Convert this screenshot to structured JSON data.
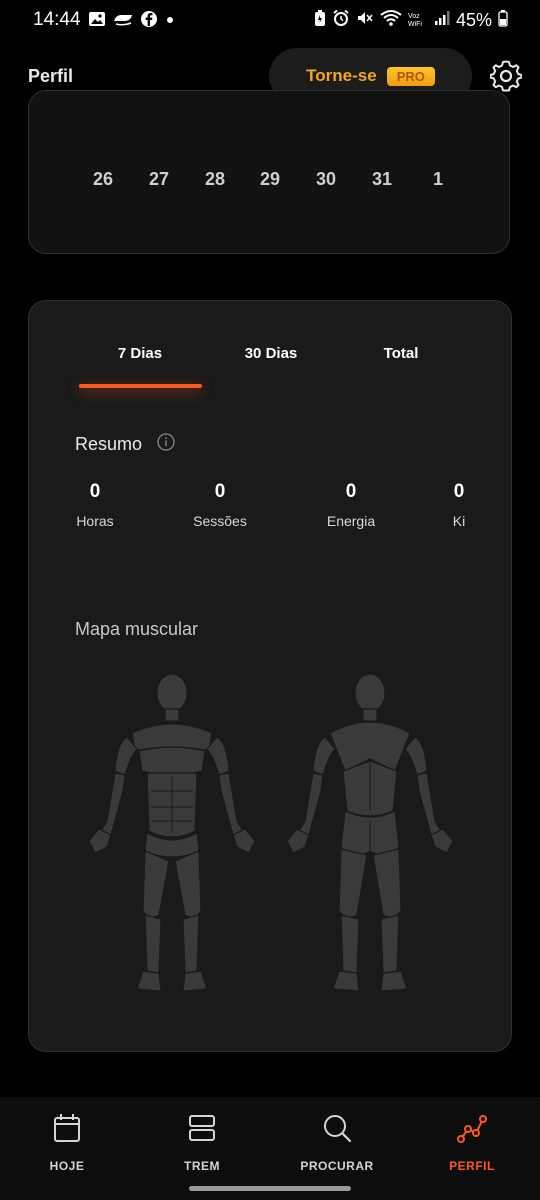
{
  "status_bar": {
    "time": "14:44",
    "battery_percent": "45%",
    "left_icons": [
      "gallery-icon",
      "ifood-icon",
      "facebook-icon",
      "dot-icon"
    ],
    "right_icons": [
      "battery-saver-icon",
      "alarm-icon",
      "mute-icon",
      "wifi-icon",
      "signal-icon",
      "battery-icon"
    ],
    "voz_wifi_label": "Voz WiFi"
  },
  "header": {
    "title": "Perfil",
    "upgrade_label": "Torne-se",
    "pro_badge": "PRO",
    "settings_icon": "gear-icon"
  },
  "calendar": {
    "days": [
      "26",
      "27",
      "28",
      "29",
      "30",
      "31",
      "1"
    ]
  },
  "stats": {
    "tabs": [
      "7 Dias",
      "30 Dias",
      "Total"
    ],
    "active_tab": "7 Dias",
    "summary_title": "Resumo",
    "items": [
      {
        "value": "0",
        "label": "Horas"
      },
      {
        "value": "0",
        "label": "Sessões"
      },
      {
        "value": "0",
        "label": "Energia"
      },
      {
        "value": "0",
        "label": "Ki"
      }
    ],
    "muscle_map_title": "Mapa muscular"
  },
  "bottom_nav": {
    "items": [
      {
        "label": "HOJE",
        "icon": "calendar-icon"
      },
      {
        "label": "TREM",
        "icon": "stack-icon"
      },
      {
        "label": "PROCURAR",
        "icon": "search-icon"
      },
      {
        "label": "PERFIL",
        "icon": "progress-chart-icon"
      }
    ],
    "active": "PERFIL"
  },
  "colors": {
    "accent": "#ff5a1f",
    "pro_gold": "#f5a623",
    "background": "#000000",
    "card": "#1a1a1a"
  }
}
